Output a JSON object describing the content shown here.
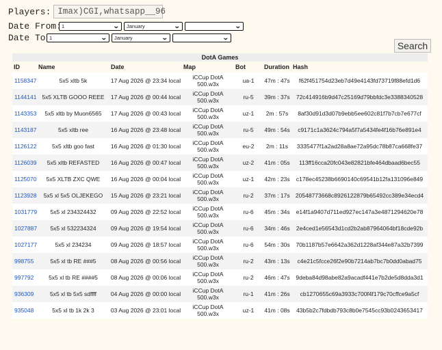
{
  "filters": {
    "players_label": "Players:",
    "players_value": "Imax)CGI,whatsapp__96",
    "date_from_label": "Date From:",
    "date_to_label": "Date To:",
    "from_day": "1",
    "from_month": "January",
    "from_year": "",
    "to_day": "1",
    "to_month": "January",
    "to_year": "",
    "search_label": "Search"
  },
  "table": {
    "caption": "DotA Games",
    "headers": [
      "ID",
      "Name",
      "Date",
      "Map",
      "Bot",
      "Duration",
      "Hash"
    ],
    "rows": [
      {
        "id": "1158347",
        "name": "5x5 xltb 5k",
        "date": "17 Aug 2026 @ 23:34 local",
        "map1": "iCCup DotA",
        "map2": "500.w3x",
        "bot": "ua-1",
        "duration": "47m : 47s",
        "hash": "f62f451754d23eb7d49e4143fd73719f88efd1d6"
      },
      {
        "id": "1144141",
        "name": "5x5 XLTB GOOO REEE",
        "date": "17 Aug 2026 @ 00:44 local",
        "map1": "iCCup DotA",
        "map2": "500.w3x",
        "bot": "ru-5",
        "duration": "39m : 37s",
        "hash": "72c414916b9d47c25169d79bbfdc3e3388340528"
      },
      {
        "id": "1143353",
        "name": "5x5 xltb by Muon6565",
        "date": "17 Aug 2026 @ 00:43 local",
        "map1": "iCCup DotA",
        "map2": "500.w3x",
        "bot": "uz-1",
        "duration": "2m : 57s",
        "hash": "8af30d91d3d07b9ebb5ee602c81f7b7cb7e677cf"
      },
      {
        "id": "1143187",
        "name": "5x5 xltb ree",
        "date": "16 Aug 2026 @ 23:48 local",
        "map1": "iCCup DotA",
        "map2": "500.w3x",
        "bot": "ru-5",
        "duration": "49m : 54s",
        "hash": "c9171c1a3624c794a5f7a5434fe4f16b76e891e4"
      },
      {
        "id": "1126122",
        "name": "5x5 xltb goo fast",
        "date": "16 Aug 2026 @ 01:30 local",
        "map1": "iCCup DotA",
        "map2": "500.w3x",
        "bot": "eu-2",
        "duration": "2m : 11s",
        "hash": "3335477f1a2ad28a8ae72a95dc78b87ca668fe37"
      },
      {
        "id": "1126039",
        "name": "5x5 xltb REFASTED",
        "date": "16 Aug 2026 @ 00:47 local",
        "map1": "iCCup DotA",
        "map2": "500.w3x",
        "bot": "uz-2",
        "duration": "41m : 05s",
        "hash": "113ff16cca20fc043e82821bfe464dbaad6bec55"
      },
      {
        "id": "1125070",
        "name": "5x5 XLTB ZXC QWE",
        "date": "16 Aug 2026 @ 00:04 local",
        "map1": "iCCup DotA",
        "map2": "500.w3x",
        "bot": "uz-1",
        "duration": "42m : 23s",
        "hash": "c178ec45238b6690140c69541b12fa131096e849"
      },
      {
        "id": "1123928",
        "name": "5x5 xl 5x5 OLJEKEGO",
        "date": "15 Aug 2026 @ 23:21 local",
        "map1": "iCCup DotA",
        "map2": "500.w3x",
        "bot": "ru-2",
        "duration": "37m : 17s",
        "hash": "20548773668c8926122879b65492cc389e34ecd4"
      },
      {
        "id": "1031779",
        "name": "5x5 xl 234324432",
        "date": "09 Aug 2026 @ 22:52 local",
        "map1": "iCCup DotA",
        "map2": "500.w3x",
        "bot": "ru-6",
        "duration": "45m : 34s",
        "hash": "e14f1a9407d711ed927ec147a3e4871294620e78"
      },
      {
        "id": "1027887",
        "name": "5x5 xl 532234324",
        "date": "09 Aug 2026 @ 19:54 local",
        "map1": "iCCup DotA",
        "map2": "500.w3x",
        "bot": "ru-6",
        "duration": "34m : 46s",
        "hash": "2e4ced1e56543d1cd2b2ab87964064bf18cde92b"
      },
      {
        "id": "1027177",
        "name": "5x5 xl 234234",
        "date": "09 Aug 2026 @ 18:57 local",
        "map1": "iCCup DotA",
        "map2": "500.w3x",
        "bot": "ru-6",
        "duration": "54m : 30s",
        "hash": "70b1187b57e6642a362d1228af344e87a32b7399"
      },
      {
        "id": "998755",
        "name": "5x5 xl tb RE ###5",
        "date": "08 Aug 2026 @ 00:56 local",
        "map1": "iCCup DotA",
        "map2": "500.w3x",
        "bot": "ru-2",
        "duration": "43m : 13s",
        "hash": "c4e21c5fcce26f2e90b7214ab7bc7b0dd0abad75"
      },
      {
        "id": "997792",
        "name": "5x5 xl tb RE ####5",
        "date": "08 Aug 2026 @ 00:06 local",
        "map1": "iCCup DotA",
        "map2": "500.w3x",
        "bot": "ru-2",
        "duration": "46m : 47s",
        "hash": "9deba84d98abe82a9acadf441e7b2de5d8dda3d1"
      },
      {
        "id": "936309",
        "name": "5x5 xl tb 5x5 sdffff",
        "date": "04 Aug 2026 @ 00:00 local",
        "map1": "iCCup DotA",
        "map2": "500.w3x",
        "bot": "ru-1",
        "duration": "41m : 26s",
        "hash": "cb1270655c69a3933c700f4f179c70cffce9a5cf"
      },
      {
        "id": "935048",
        "name": "5x5 xl tb 1k 2k 3",
        "date": "03 Aug 2026 @ 23:01 local",
        "map1": "iCCup DotA",
        "map2": "500.w3x",
        "bot": "uz-1",
        "duration": "41m : 08s",
        "hash": "43b5b2c7fdbdb793c8b0e7545cc93b0243653417"
      }
    ]
  }
}
